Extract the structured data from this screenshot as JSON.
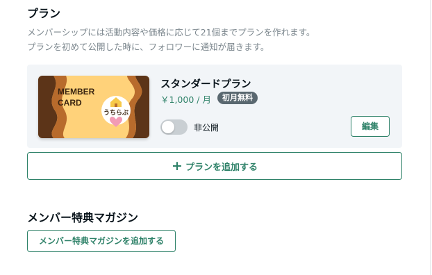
{
  "plans": {
    "title": "プラン",
    "description": [
      "メンバーシップには活動内容や価格に応じて21個までプランを作れます。",
      "プランを初めて公開した時に、フォロワーに通知が届きます。"
    ],
    "items": [
      {
        "name": "スタンダードプラン",
        "price": "￥1,000 / 月",
        "badge": "初月無料",
        "visibility_label": "非公開",
        "visibility_on": false,
        "edit_label": "編集",
        "thumbnail": {
          "title_lines": [
            "MEMBER",
            "CARD"
          ],
          "brand": "うちらぶ"
        }
      }
    ],
    "add_label": "プランを追加する"
  },
  "magazine": {
    "title": "メンバー特典マガジン",
    "add_label": "メンバー特典マガジンを追加する"
  },
  "colors": {
    "accent": "#2f8269",
    "card_bg": "#f2f5f8",
    "badge_bg": "#5a6870",
    "toggle_off": "#c9cfd3"
  }
}
